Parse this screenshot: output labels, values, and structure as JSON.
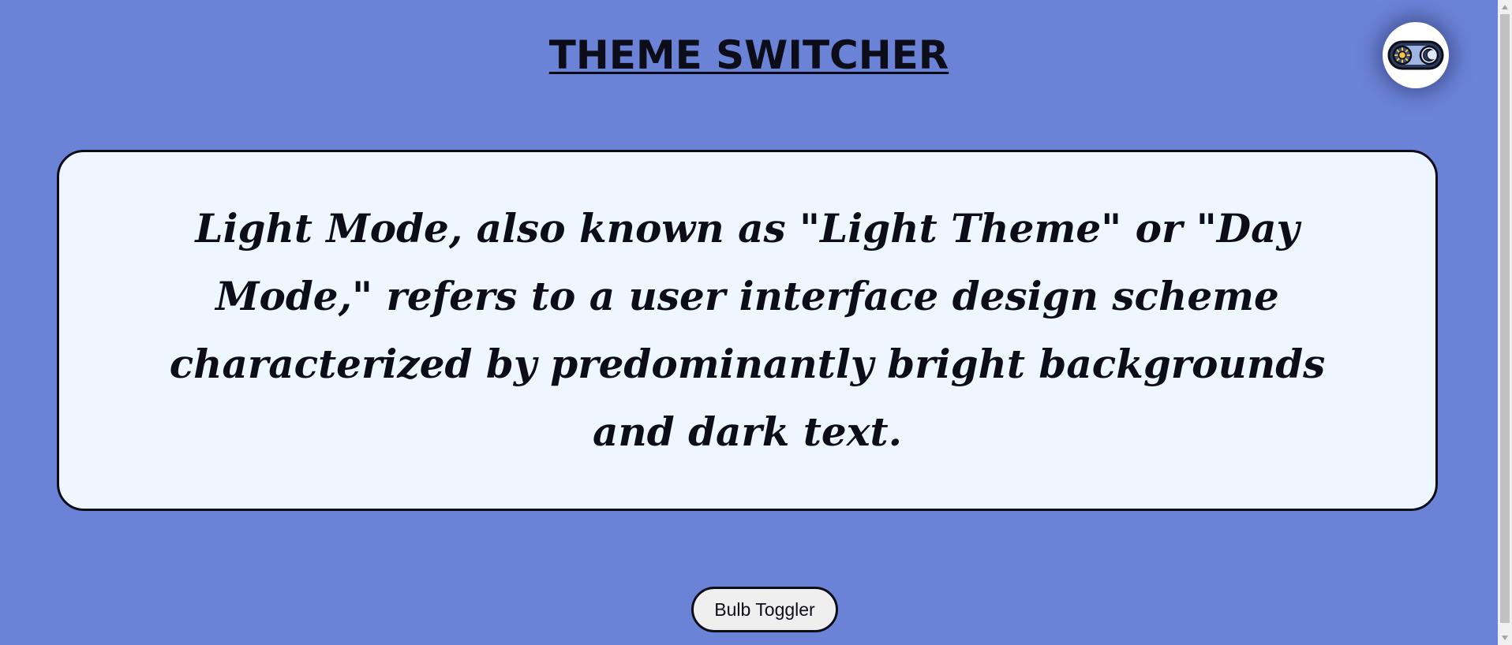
{
  "header": {
    "title": "THEME SWITCHER"
  },
  "theme_toggle": {
    "icon": "sun-moon-toggle-icon",
    "state": "light"
  },
  "card": {
    "text": "Light Mode, also known as \"Light Theme\" or \"Day Mode,\" refers to a user interface design scheme characterized by predominantly bright backgrounds and dark text."
  },
  "bulb_button": {
    "label": "Bulb Toggler"
  },
  "colors": {
    "background": "#6b83d6",
    "card_background": "#eef7ff",
    "text": "#0d0d1a",
    "toggle_track": "#2a3a5c",
    "sun": "#f5c542",
    "moon_knob": "#dce8f7"
  }
}
